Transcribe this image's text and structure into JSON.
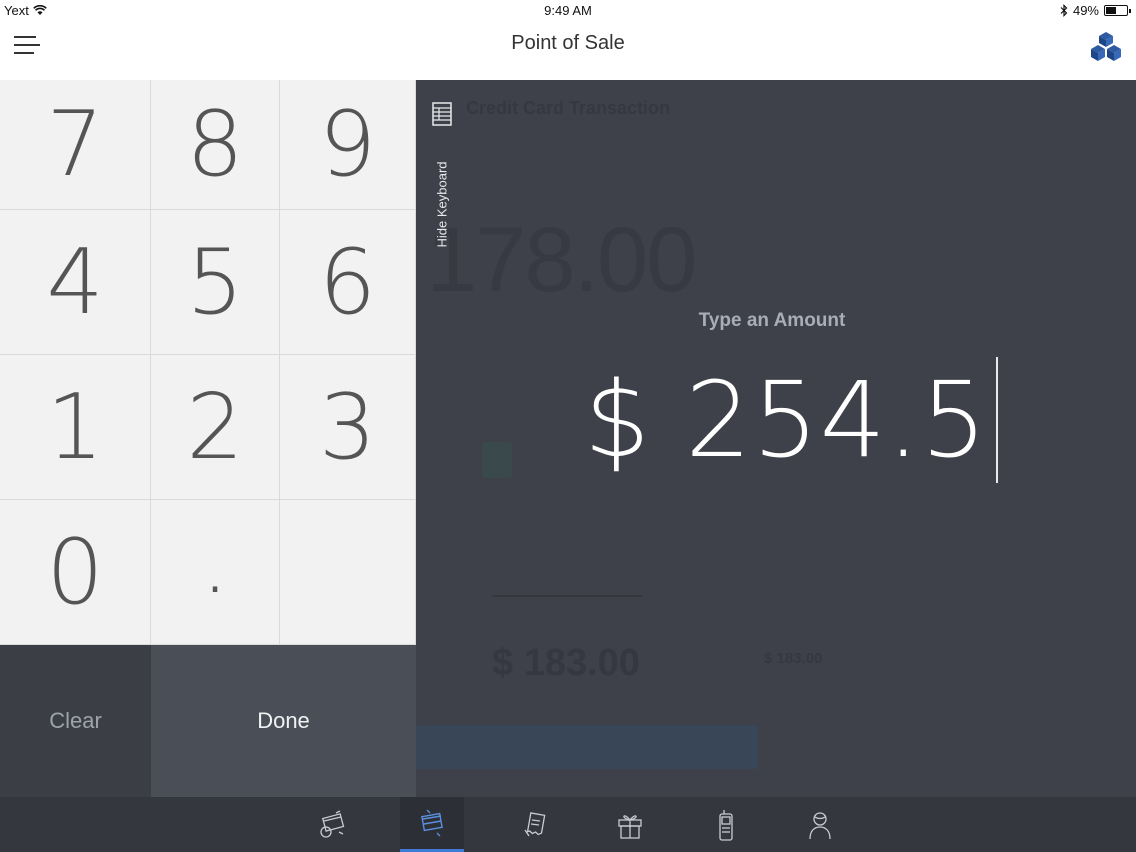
{
  "status_bar": {
    "carrier": "Yext",
    "time": "9:49 AM",
    "battery_percent": "49%",
    "battery_level": 0.49
  },
  "nav": {
    "title": "Point of Sale"
  },
  "background": {
    "section_title": "Credit Card Transaction",
    "amount": "178.00",
    "total": "$ 183.00",
    "total_small": "$ 183.00"
  },
  "hide_keyboard_label": "Hide Keyboard",
  "prompt": "Type an Amount",
  "amount_display": "$ 254.5",
  "keypad": {
    "keys": [
      "7",
      "8",
      "9",
      "4",
      "5",
      "6",
      "1",
      "2",
      "3",
      "0",
      ".",
      ""
    ],
    "clear_label": "Clear",
    "done_label": "Done"
  },
  "colors": {
    "accent": "#3e7bd6",
    "panel_dark": "#3e4149",
    "keypad_bg": "#f2f2f2"
  },
  "tabs": [
    {
      "icon": "card-swipe-icon",
      "active": false
    },
    {
      "icon": "card-transaction-icon",
      "active": true
    },
    {
      "icon": "receipt-icon",
      "active": false
    },
    {
      "icon": "gift-icon",
      "active": false
    },
    {
      "icon": "mobile-device-icon",
      "active": false
    },
    {
      "icon": "customer-icon",
      "active": false
    }
  ]
}
